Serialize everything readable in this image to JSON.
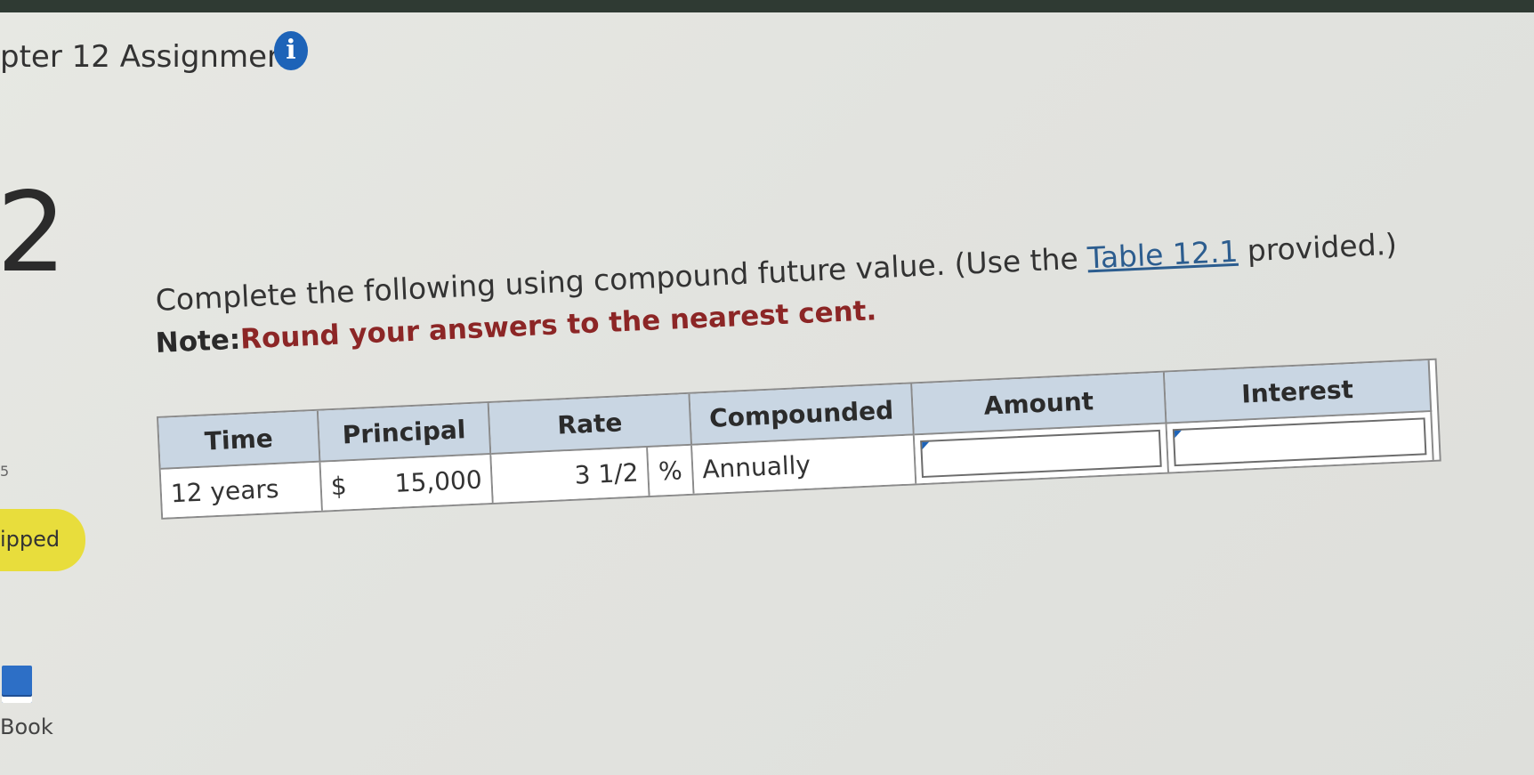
{
  "assignment": {
    "title": "pter 12 Assignment",
    "info_icon": "info-icon"
  },
  "question": {
    "number": "2",
    "points_marker": "5",
    "status": "ipped",
    "ebook_label": "Book",
    "text_before_link": "Complete the following using compound future value. (Use the ",
    "link_text": "Table 12.1",
    "text_after_link": " provided.)",
    "note_label": "Note:",
    "note_text": "Round your answers to the nearest cent."
  },
  "table": {
    "headers": {
      "time": "Time",
      "principal": "Principal",
      "rate": "Rate",
      "compounded": "Compounded",
      "amount": "Amount",
      "interest": "Interest"
    },
    "row": {
      "time": "12 years",
      "principal_currency": "$",
      "principal": "15,000",
      "rate": "3 1/2",
      "rate_unit": "%",
      "compounded": "Annually",
      "amount": "",
      "interest": ""
    }
  },
  "colors": {
    "header_bg": "#c9d6e3",
    "status_bg": "#e8dd3c",
    "info_icon_bg": "#1d63b8",
    "note_red": "#8c2626"
  }
}
